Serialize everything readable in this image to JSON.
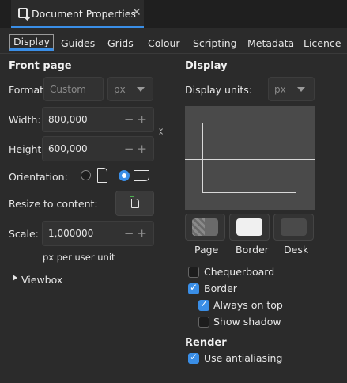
{
  "window": {
    "title": "Document Properties",
    "close": "✕"
  },
  "tabs": [
    "Display",
    "Guides",
    "Grids",
    "Colour",
    "Scripting",
    "Metadata",
    "Licence"
  ],
  "front_page": {
    "heading": "Front page",
    "format_label": "Format:",
    "format_value": "Custom",
    "format_unit": "px",
    "width_label": "Width:",
    "width_value": "800,000",
    "height_label": "Height:",
    "height_value": "600,000",
    "orientation_label": "Orientation:",
    "resize_label": "Resize to content:",
    "scale_label": "Scale:",
    "scale_value": "1,000000",
    "scale_hint": "px per user unit",
    "viewbox_label": "Viewbox"
  },
  "display": {
    "heading": "Display",
    "units_label": "Display units:",
    "units_value": "px",
    "bg_buttons": [
      "Page",
      "Border",
      "Desk"
    ],
    "checkboxes": [
      {
        "label": "Chequerboard",
        "checked": false
      },
      {
        "label": "Border",
        "checked": true
      },
      {
        "label": "Always on top",
        "checked": true
      },
      {
        "label": "Show shadow",
        "checked": false
      }
    ]
  },
  "render": {
    "heading": "Render",
    "antialias_label": "Use antialiasing",
    "antialias_checked": true
  },
  "colors": {
    "accent": "#3a8ee6",
    "background": "#2b2b2b",
    "field": "#323232",
    "preview": "#4a4a4a"
  }
}
